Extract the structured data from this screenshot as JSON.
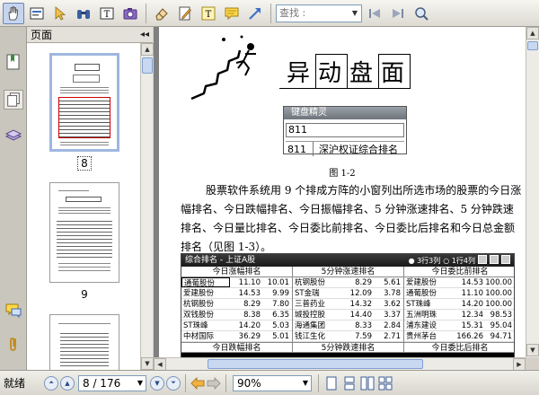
{
  "toolbar": {
    "search_placeholder": "查找 :"
  },
  "sidebar": {
    "panel_title": "页面",
    "collapse_glyph": "◂◂",
    "thumbnails": [
      {
        "label": "8",
        "selected": true
      },
      {
        "label": "9",
        "selected": false
      }
    ]
  },
  "document": {
    "page_title": [
      "异",
      "动",
      "盘",
      "面"
    ],
    "wizard": {
      "header": "键盘精灵",
      "input_value": "811",
      "result_code": "811",
      "result_name": "深沪权证综合排名"
    },
    "figure_caption": "图 1-2",
    "paragraph": "股票软件系统用 9 个排成方阵的小窗列出所选市场的股票的今日涨幅排名、今日跌幅排名、今日振幅排名、5 分钟涨速排名、5 分钟跌速排名、今日量比排名、今日委比前排名、今日委比后排名和今日总金额排名（见图 1-3）。",
    "screenshot": {
      "title": "综合排名 - 上证A股",
      "options": [
        "3行3列",
        "1行4列"
      ],
      "sections": [
        {
          "header": "今日涨幅排名",
          "rows": [
            {
              "name": "通葡股份",
              "a": "11.10",
              "b": "10.01",
              "selected": true
            },
            {
              "name": "爱建股份",
              "a": "14.53",
              "b": "9.99"
            },
            {
              "name": "杭钢股份",
              "a": "8.29",
              "b": "7.80"
            },
            {
              "name": "双钱股份",
              "a": "8.38",
              "b": "6.35"
            },
            {
              "name": "ST珠峰",
              "a": "14.20",
              "b": "5.03"
            },
            {
              "name": "中材国际",
              "a": "36.29",
              "b": "5.01"
            }
          ],
          "footer": "今日跌幅排名"
        },
        {
          "header": "5分钟涨速排名",
          "rows": [
            {
              "name": "杭钢股份",
              "a": "8.29",
              "b": "5.61"
            },
            {
              "name": "ST金瑞",
              "a": "12.09",
              "b": "3.78"
            },
            {
              "name": "三普药业",
              "a": "14.32",
              "b": "3.62"
            },
            {
              "name": "城投控股",
              "a": "14.40",
              "b": "3.37"
            },
            {
              "name": "海通集团",
              "a": "8.33",
              "b": "2.84"
            },
            {
              "name": "钱江生化",
              "a": "7.59",
              "b": "2.71"
            }
          ],
          "footer": "5分钟跌速排名"
        },
        {
          "header": "今日委比前排名",
          "rows": [
            {
              "name": "爱建股份",
              "a": "14.53",
              "b": "100.00"
            },
            {
              "name": "通葡股份",
              "a": "11.10",
              "b": "100.00"
            },
            {
              "name": "ST珠峰",
              "a": "14.20",
              "b": "100.00"
            },
            {
              "name": "五洲明珠",
              "a": "12.34",
              "b": "98.53"
            },
            {
              "name": "浦东建设",
              "a": "15.31",
              "b": "95.04"
            },
            {
              "name": "贵州茅台",
              "a": "166.26",
              "b": "94.71"
            }
          ],
          "footer": "今日委比后排名"
        }
      ]
    }
  },
  "statusbar": {
    "status": "就绪",
    "page_indicator": "8 / 176",
    "zoom": "90%"
  }
}
